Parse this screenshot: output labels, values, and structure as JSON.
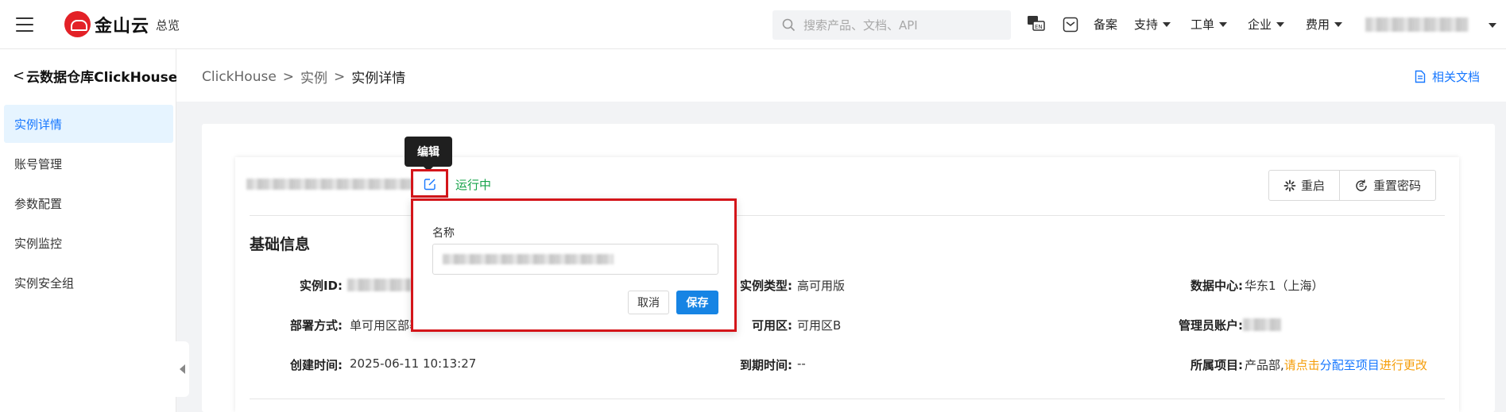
{
  "topbar": {
    "overview_label": "总览",
    "search_placeholder": "搜索产品、文档、API",
    "filing_label": "备案",
    "nav": [
      {
        "label": "支持"
      },
      {
        "label": "工单"
      },
      {
        "label": "企业"
      },
      {
        "label": "费用"
      }
    ],
    "icons": [
      "menu-icon",
      "kingsoft-cloud-logo",
      "search-icon",
      "language-toggle-icon",
      "message-icon"
    ]
  },
  "logo": {
    "text": "金山云",
    "brand_color": "#e32127"
  },
  "sidebar": {
    "title": "云数据仓库ClickHouse",
    "back_glyph": "<",
    "items": [
      {
        "label": "实例详情",
        "active": true
      },
      {
        "label": "账号管理",
        "active": false
      },
      {
        "label": "参数配置",
        "active": false
      },
      {
        "label": "实例监控",
        "active": false
      },
      {
        "label": "实例安全组",
        "active": false
      }
    ]
  },
  "breadcrumb": {
    "items": [
      "ClickHouse",
      "实例",
      "实例详情"
    ],
    "separator": ">"
  },
  "docs_link": "相关文档",
  "instance": {
    "status": "运行中",
    "status_color": "#16a34a",
    "actions": {
      "restart": "重启",
      "reset_password": "重置密码"
    }
  },
  "basic_info": {
    "title": "基础信息",
    "fields": {
      "instance_id_label": "实例ID:",
      "instance_type_label": "实例类型:",
      "instance_type_value": "高可用版",
      "datacenter_label": "数据中心:",
      "datacenter_value": "华东1（上海）",
      "deploy_label": "部署方式:",
      "deploy_value": "单可用区部署",
      "zone_label": "可用区:",
      "zone_value": "可用区B",
      "admin_label": "管理员账户:",
      "created_label": "创建时间:",
      "created_value": "2025-06-11 10:13:27",
      "expire_label": "到期时间:",
      "expire_value": "--",
      "project_label": "所属项目:",
      "project_value": "产品部,",
      "project_link_1": "请点击",
      "project_link_2": "分配至项目",
      "project_link_3": "进行更改"
    }
  },
  "tooltip": {
    "text": "编辑"
  },
  "popover": {
    "name_label": "名称",
    "cancel": "取消",
    "save": "保存",
    "save_color": "#1684e4"
  },
  "highlight_color": "#d4151a"
}
